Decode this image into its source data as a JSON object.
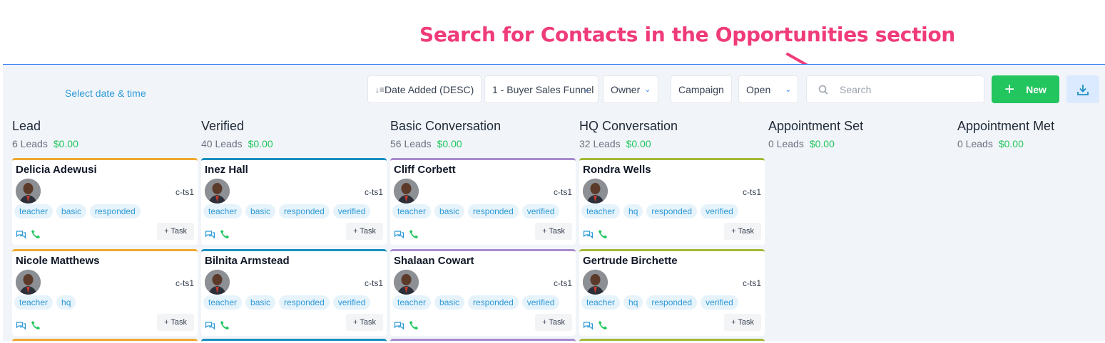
{
  "annotation": {
    "text": "Search for Contacts in the Opportunities section"
  },
  "toolbar": {
    "datetime": "Select date & time",
    "sort": "Date Added (DESC)",
    "pipeline": "1 - Buyer Sales Funnel",
    "owner": "Owner",
    "campaign": "Campaign",
    "status": "Open",
    "search_placeholder": "Search",
    "new_label": "New"
  },
  "columns": [
    {
      "title": "Lead",
      "count": "6 Leads",
      "amount": "$0.00",
      "color": "#f0a830",
      "cards": [
        {
          "name": "Delicia Adewusi",
          "code": "c-ts1",
          "tags": [
            "teacher",
            "basic",
            "responded"
          ],
          "task": "+ Task"
        },
        {
          "name": "Nicole Matthews",
          "code": "c-ts1",
          "tags": [
            "teacher",
            "hq"
          ],
          "task": "+ Task"
        }
      ]
    },
    {
      "title": "Verified",
      "count": "40 Leads",
      "amount": "$0.00",
      "color": "#1a8fc0",
      "cards": [
        {
          "name": "Inez Hall",
          "code": "c-ts1",
          "tags": [
            "teacher",
            "basic",
            "responded",
            "verified"
          ],
          "task": "+ Task"
        },
        {
          "name": "Bilnita Armstead",
          "code": "c-ts1",
          "tags": [
            "teacher",
            "basic",
            "responded",
            "verified"
          ],
          "task": "+ Task"
        }
      ]
    },
    {
      "title": "Basic Conversation",
      "count": "56 Leads",
      "amount": "$0.00",
      "color": "#a78bcf",
      "cards": [
        {
          "name": "Cliff Corbett",
          "code": "c-ts1",
          "tags": [
            "teacher",
            "basic",
            "responded",
            "verified"
          ],
          "task": "+ Task"
        },
        {
          "name": "Shalaan Cowart",
          "code": "c-ts1",
          "tags": [
            "teacher",
            "basic",
            "responded",
            "verified"
          ],
          "task": "+ Task"
        }
      ]
    },
    {
      "title": "HQ Conversation",
      "count": "32 Leads",
      "amount": "$0.00",
      "color": "#a3b837",
      "cards": [
        {
          "name": "Rondra Wells",
          "code": "c-ts1",
          "tags": [
            "teacher",
            "hq",
            "responded",
            "verified"
          ],
          "task": "+ Task"
        },
        {
          "name": "Gertrude Birchette",
          "code": "c-ts1",
          "tags": [
            "teacher",
            "hq",
            "responded",
            "verified"
          ],
          "task": "+ Task"
        }
      ]
    },
    {
      "title": "Appointment Set",
      "count": "0 Leads",
      "amount": "$0.00",
      "color": "#cccccc",
      "cards": []
    },
    {
      "title": "Appointment Met",
      "count": "0 Leads",
      "amount": "$0.00",
      "color": "#cccccc",
      "cards": []
    }
  ]
}
